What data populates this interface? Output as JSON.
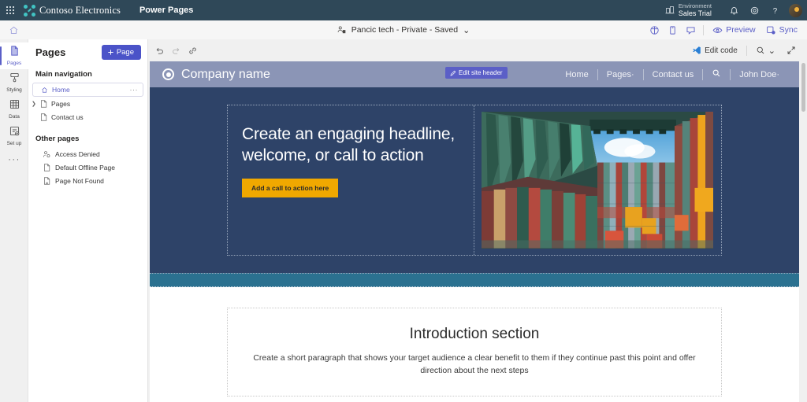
{
  "suite_bar": {
    "waffle_label": "App launcher",
    "brand": "Contoso Electronics",
    "app_name": "Power Pages",
    "environment_label": "Environment",
    "environment_name": "Sales Trial",
    "icons": [
      "environment-icon",
      "notifications-bell-icon",
      "settings-gear-icon",
      "help-question-icon",
      "account-avatar"
    ]
  },
  "command_bar": {
    "home_icon": "home-icon",
    "site_title": "Pancic tech - Private - Saved",
    "site_chevron": "⌄",
    "actions": [
      {
        "name": "accessibility-checker",
        "label": ""
      },
      {
        "name": "mobile-preview",
        "label": ""
      },
      {
        "name": "feedback",
        "label": ""
      }
    ],
    "preview_label": "Preview",
    "sync_label": "Sync"
  },
  "rail": {
    "items": [
      {
        "label": "Pages",
        "icon": "pages-icon",
        "active": true
      },
      {
        "label": "Styling",
        "icon": "styling-icon",
        "active": false
      },
      {
        "label": "Data",
        "icon": "data-table-icon",
        "active": false
      },
      {
        "label": "Set up",
        "icon": "setup-icon",
        "active": false
      }
    ],
    "more_label": "···"
  },
  "pages_panel": {
    "title": "Pages",
    "add_button": "Page",
    "add_icon": "plus-icon",
    "main_nav_label": "Main navigation",
    "main_nav": [
      {
        "label": "Home",
        "icon": "home-small-icon",
        "selected": true,
        "expandable": false,
        "overflow": "···"
      },
      {
        "label": "Pages",
        "icon": "page-file-icon",
        "selected": false,
        "expandable": true
      },
      {
        "label": "Contact us",
        "icon": "page-file-icon",
        "selected": false,
        "expandable": false
      }
    ],
    "other_pages_label": "Other pages",
    "other_pages": [
      {
        "label": "Access Denied",
        "icon": "access-denied-person-icon"
      },
      {
        "label": "Default Offline Page",
        "icon": "page-file-icon"
      },
      {
        "label": "Page Not Found",
        "icon": "page-not-found-icon"
      }
    ]
  },
  "canvas_toolbar": {
    "undo_icon": "undo-arrow-icon",
    "redo_icon": "redo-arrow-icon",
    "style_icon": "link-style-icon",
    "edit_code_label": "Edit code",
    "edit_code_icon": "vscode-icon",
    "zoom_icon": "zoom-magnifier-icon",
    "zoom_chevron": "⌄",
    "expand_icon": "expand-diagonal-icon"
  },
  "website": {
    "header": {
      "logo_icon": "circle-logo-icon",
      "company_name": "Company name",
      "edit_header_button": "Edit site header",
      "edit_header_icon": "pencil-icon",
      "nav": [
        {
          "label": "Home",
          "caret": false
        },
        {
          "label": "Pages",
          "caret": true
        },
        {
          "label": "Contact us",
          "caret": false
        },
        {
          "label": "",
          "caret": false,
          "icon": "search-icon"
        },
        {
          "label": "John Doe",
          "caret": true
        }
      ]
    },
    "hero": {
      "headline": "Create an engaging headline, welcome, or call to action",
      "cta_label": "Add a call to action here",
      "image_alt": "shipping-containers-photo"
    },
    "intro": {
      "heading": "Introduction section",
      "paragraph": "Create a short paragraph that shows your target audience a clear benefit to them if they continue past this point and offer direction about the next steps"
    }
  },
  "colors": {
    "suite_bar": "#2f4858",
    "accent_purple": "#5b5fc7",
    "site_header": "#8b95b6",
    "hero_navy": "#2e4368",
    "band_teal": "#2b7190",
    "cta_orange": "#f0a800",
    "brand_teal": "#41c4c4"
  }
}
